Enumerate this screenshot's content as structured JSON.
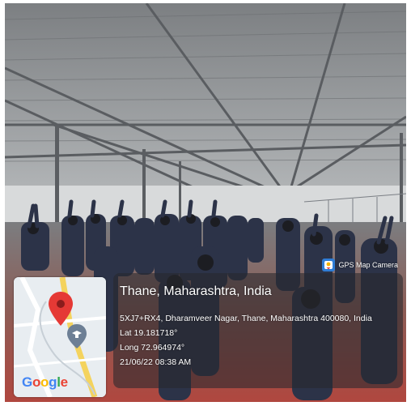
{
  "photo": {
    "description_hidden": ""
  },
  "geotag": {
    "app_badge": "GPS Map Camera",
    "title": "Thane, Maharashtra, India",
    "address": "5XJ7+RX4, Dharamveer Nagar, Thane, Maharashtra 400080, India",
    "latitude": "Lat 19.181718°",
    "longitude": "Long 72.964974°",
    "datetime": "21/06/22 08:38 AM",
    "map_brand": {
      "G": "G",
      "o1": "o",
      "o2": "o",
      "g": "g",
      "l": "l",
      "e": "e"
    },
    "pin_color": "#e53935",
    "map_road_color": "#f4d35e"
  }
}
